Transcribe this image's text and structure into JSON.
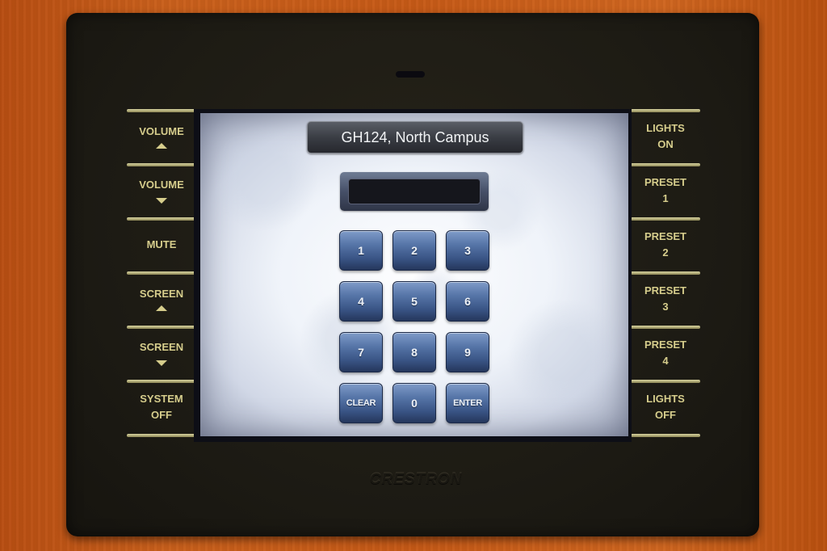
{
  "device": {
    "brand": "CRESTRON"
  },
  "screen": {
    "room_title": "GH124, North Campus",
    "entry_display_value": "",
    "keypad": [
      {
        "label": "1",
        "name": "key-1"
      },
      {
        "label": "2",
        "name": "key-2"
      },
      {
        "label": "3",
        "name": "key-3"
      },
      {
        "label": "4",
        "name": "key-4"
      },
      {
        "label": "5",
        "name": "key-5"
      },
      {
        "label": "6",
        "name": "key-6"
      },
      {
        "label": "7",
        "name": "key-7"
      },
      {
        "label": "8",
        "name": "key-8"
      },
      {
        "label": "9",
        "name": "key-9"
      },
      {
        "label": "CLEAR",
        "name": "key-clear"
      },
      {
        "label": "0",
        "name": "key-0"
      },
      {
        "label": "ENTER",
        "name": "key-enter"
      }
    ]
  },
  "left_buttons": [
    {
      "line1": "VOLUME",
      "line2": "",
      "icon": "arrow-up"
    },
    {
      "line1": "VOLUME",
      "line2": "",
      "icon": "arrow-down"
    },
    {
      "line1": "MUTE",
      "line2": "",
      "icon": ""
    },
    {
      "line1": "SCREEN",
      "line2": "",
      "icon": "arrow-up"
    },
    {
      "line1": "SCREEN",
      "line2": "",
      "icon": "arrow-down"
    },
    {
      "line1": "SYSTEM",
      "line2": "OFF",
      "icon": ""
    }
  ],
  "right_buttons": [
    {
      "line1": "LIGHTS",
      "line2": "ON"
    },
    {
      "line1": "PRESET",
      "line2": "1"
    },
    {
      "line1": "PRESET",
      "line2": "2"
    },
    {
      "line1": "PRESET",
      "line2": "3"
    },
    {
      "line1": "PRESET",
      "line2": "4"
    },
    {
      "line1": "LIGHTS",
      "line2": "OFF"
    }
  ]
}
